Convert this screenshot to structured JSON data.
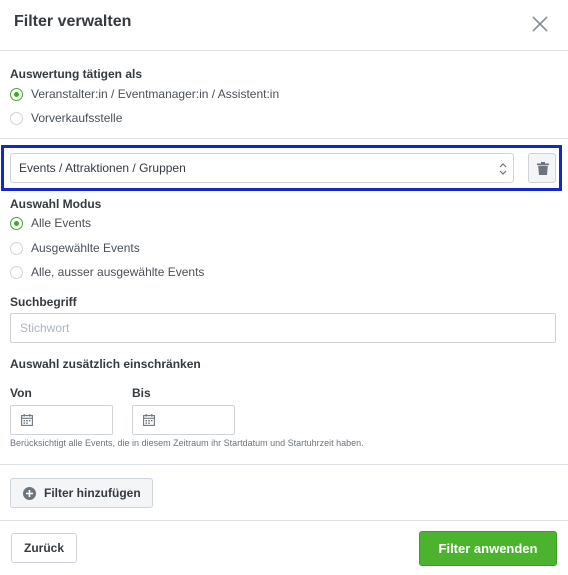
{
  "modal": {
    "title": "Filter verwalten"
  },
  "evaluation": {
    "label": "Auswertung tätigen als",
    "options": [
      {
        "label": "Veranstalter:in / Eventmanager:in / Assistent:in",
        "checked": true
      },
      {
        "label": "Vorverkaufsstelle",
        "checked": false
      }
    ]
  },
  "filter_type": {
    "selected": "Events / Attraktionen / Gruppen"
  },
  "selection_mode": {
    "label": "Auswahl Modus",
    "options": [
      {
        "label": "Alle Events",
        "checked": true
      },
      {
        "label": "Ausgewählte Events",
        "checked": false
      },
      {
        "label": "Alle, ausser ausgewählte Events",
        "checked": false
      }
    ]
  },
  "search": {
    "label": "Suchbegriff",
    "placeholder": "Stichwort",
    "value": ""
  },
  "restrict": {
    "label": "Auswahl zusätzlich einschränken",
    "from_label": "Von",
    "to_label": "Bis",
    "from_value": "",
    "to_value": "",
    "hint": "Berücksichtigt alle Events, die in diesem Zeitraum ihr Startdatum und Startuhrzeit haben."
  },
  "actions": {
    "add_filter": "Filter hinzufügen",
    "back": "Zurück",
    "apply": "Filter anwenden"
  },
  "colors": {
    "accent": "#4cb32f",
    "highlight": "#1428c8"
  },
  "icons": {
    "close": "close-icon",
    "trash": "trash-icon",
    "calendar": "calendar-icon",
    "add": "plus-circle-icon",
    "select": "sort-arrows-icon"
  }
}
